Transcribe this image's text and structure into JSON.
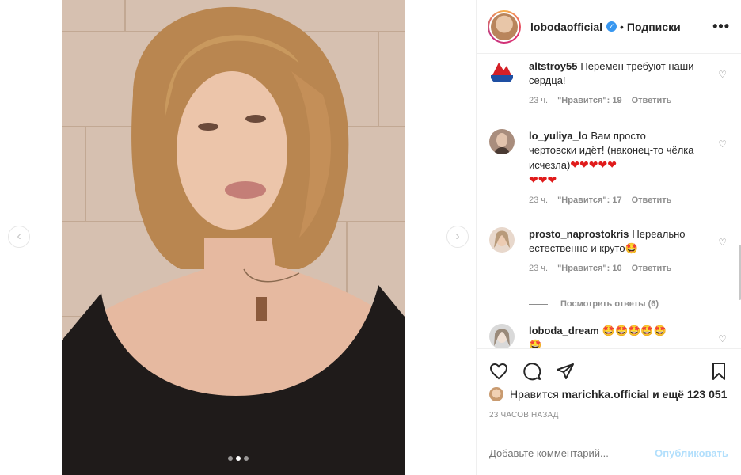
{
  "post": {
    "owner": "lobodaofficial",
    "separator": "•",
    "follow_label": "Подписки",
    "more_label": "•••"
  },
  "media": {
    "prev_icon": "chevron-left-icon",
    "next_icon": "chevron-right-icon",
    "carousel_total": 3,
    "carousel_active": 2
  },
  "comments": [
    {
      "user": "altstroy55",
      "text": "Перемен требуют наши сердца!",
      "time": "23 ч.",
      "likes": "\"Нравится\": 19",
      "reply": "Ответить"
    },
    {
      "user": "lo_yuliya_lo",
      "text": "Вам просто чертовски идёт! (наконец-то чёлка исчезла)",
      "hearts": "❤❤❤❤❤",
      "hearts2": "❤❤❤",
      "time": "23 ч.",
      "likes": "\"Нравится\": 17",
      "reply": "Ответить"
    },
    {
      "user": "prosto_naprostokris",
      "text": "Нереально естественно и круто",
      "emoji": "🤩",
      "time": "23 ч.",
      "likes": "\"Нравится\": 10",
      "reply": "Ответить"
    },
    {
      "user": "loboda_dream",
      "emoji": "🤩🤩🤩🤩🤩",
      "emoji2": "🤩"
    }
  ],
  "view_replies": "Посмотреть ответы (6)",
  "likes": {
    "prefix": "Нравится",
    "user": "marichka.official",
    "suffix": "и ещё 123 051"
  },
  "timestamp": "23 ЧАСОВ НАЗАД",
  "composer": {
    "placeholder": "Добавьте комментарий...",
    "publish": "Опубликовать"
  },
  "colors": {
    "verified": "#3897f0",
    "publish_disabled": "#b2dffc",
    "meta_text": "#8e8e8e"
  }
}
